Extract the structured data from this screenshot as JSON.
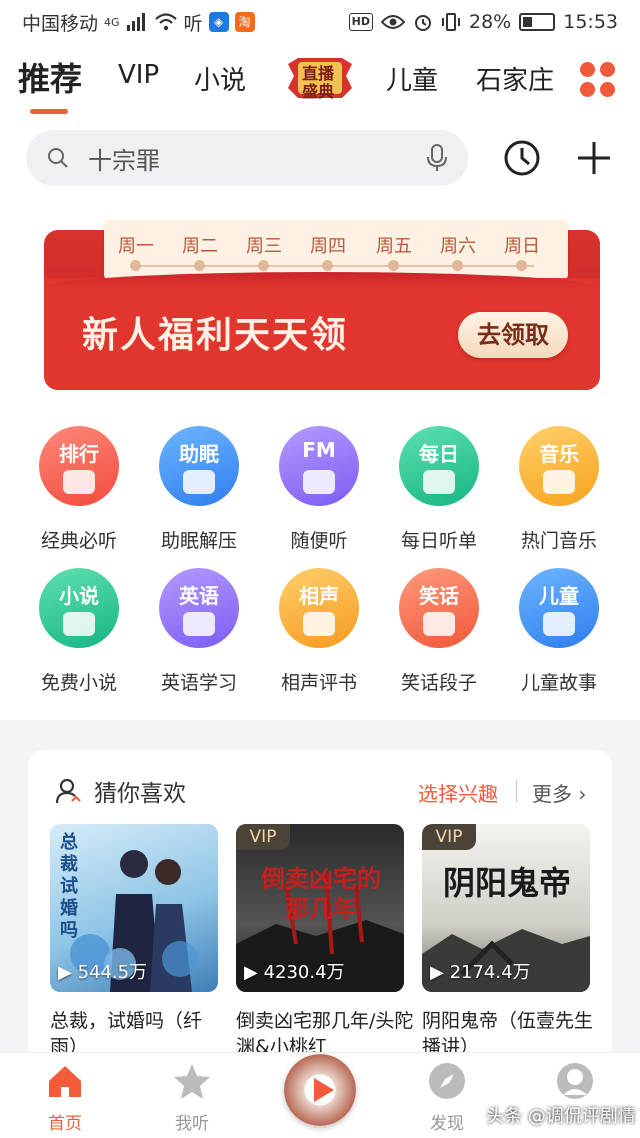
{
  "status_bar": {
    "carrier": "中国移动",
    "network": "4G",
    "listen_glyph": "听",
    "taobao_glyph": "淘",
    "hd": "HD",
    "battery": "28%",
    "time": "15:53"
  },
  "top_nav": {
    "tabs": [
      {
        "label": "推荐",
        "active": true
      },
      {
        "label": "VIP"
      },
      {
        "label": "小说"
      },
      {
        "label": "儿童"
      },
      {
        "label": "石家庄"
      }
    ],
    "live_badge_top": "直播",
    "live_badge_bottom": "盛典",
    "accent": "#f25c3b"
  },
  "search": {
    "placeholder": "十宗罪"
  },
  "banner": {
    "weekdays": [
      "周一",
      "周二",
      "周三",
      "周四",
      "周五",
      "周六",
      "周日"
    ],
    "title": "新人福利天天领",
    "button": "去领取"
  },
  "categories": [
    {
      "tag": "排行",
      "label": "经典必听",
      "colors": [
        "#ff8a7a",
        "#f04a3c"
      ],
      "icon": "podium-icon"
    },
    {
      "tag": "助眠",
      "label": "助眠解压",
      "colors": [
        "#6db6ff",
        "#2f7dee"
      ],
      "icon": "moon-sleep-icon"
    },
    {
      "tag": "FM",
      "label": "随便听",
      "colors": [
        "#b39bff",
        "#7b5cf2"
      ],
      "icon": "radio-icon"
    },
    {
      "tag": "每日",
      "label": "每日听单",
      "colors": [
        "#5fe0b0",
        "#17b583"
      ],
      "icon": "calendar-icon"
    },
    {
      "tag": "音乐",
      "label": "热门音乐",
      "colors": [
        "#ffd06a",
        "#f7a21d"
      ],
      "icon": "music-note-icon"
    },
    {
      "tag": "小说",
      "label": "免费小说",
      "colors": [
        "#5fe0b0",
        "#17b583"
      ],
      "icon": "book-icon"
    },
    {
      "tag": "英语",
      "label": "英语学习",
      "colors": [
        "#b39bff",
        "#7b5cf2"
      ],
      "icon": "english-icon"
    },
    {
      "tag": "相声",
      "label": "相声评书",
      "colors": [
        "#ffcf6b",
        "#f69a1f"
      ],
      "icon": "fan-icon"
    },
    {
      "tag": "笑话",
      "label": "笑话段子",
      "colors": [
        "#ff9a7c",
        "#f2563a"
      ],
      "icon": "laugh-icon"
    },
    {
      "tag": "儿童",
      "label": "儿童故事",
      "colors": [
        "#6db6ff",
        "#2f7dee"
      ],
      "icon": "baby-icon"
    }
  ],
  "recommend": {
    "title": "猜你喜欢",
    "choose_interest": "选择兴趣",
    "more": "更多",
    "books": [
      {
        "title": "总裁，试婚吗（纤雨）",
        "plays": "544.5万",
        "vip": "",
        "cover_text": "总裁试婚吗"
      },
      {
        "title": "倒卖凶宅那几年/头陀渊&小桃红",
        "plays": "4230.4万",
        "vip": "VIP",
        "cover_text": "倒卖凶宅的那几年"
      },
      {
        "title": "阴阳鬼帝（伍壹先生播讲）",
        "plays": "2174.4万",
        "vip": "VIP",
        "cover_text": "阴阳鬼帝"
      }
    ]
  },
  "bottom_tabs": [
    {
      "label": "首页",
      "active": true,
      "icon": "home-icon"
    },
    {
      "label": "我听",
      "icon": "star-icon"
    },
    {
      "label": "",
      "icon": "play-disc-icon"
    },
    {
      "label": "发现",
      "icon": "compass-icon"
    },
    {
      "label": "",
      "icon": "profile-icon"
    }
  ],
  "watermark": "头条 @调侃评剧情"
}
